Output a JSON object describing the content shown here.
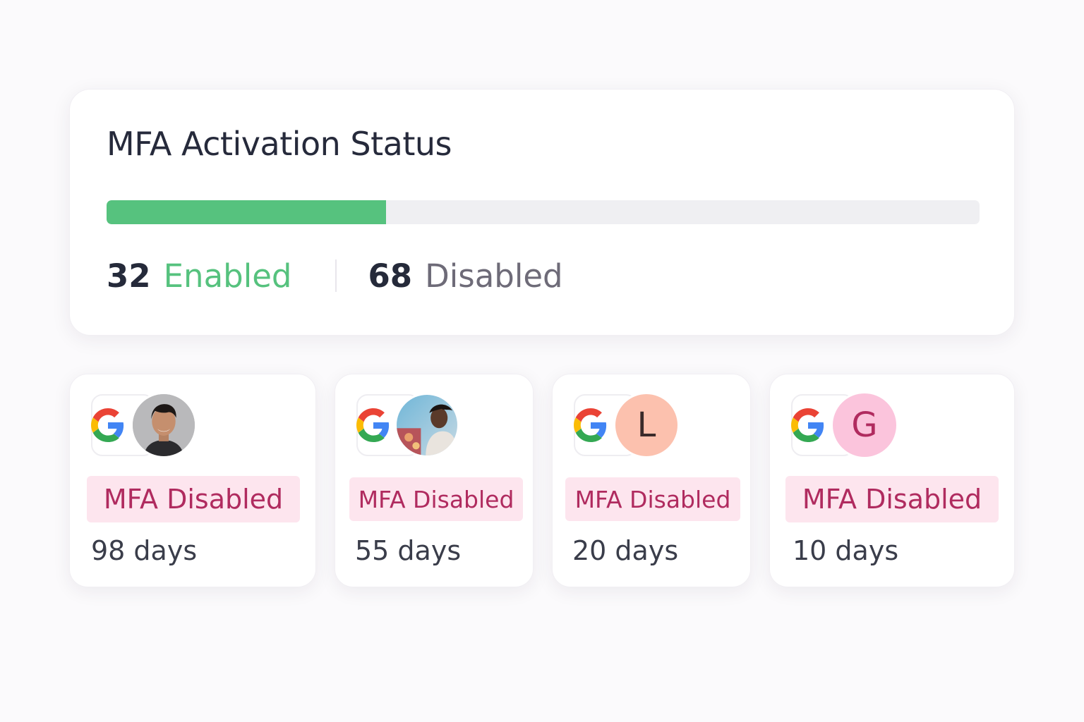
{
  "status": {
    "title": "MFA Activation Status",
    "enabled_count": "32",
    "enabled_label": "Enabled",
    "disabled_count": "68",
    "disabled_label": "Disabled",
    "enabled_fraction": 0.32,
    "colors": {
      "enabled": "#56c27e",
      "track": "#efeff2",
      "disabled_text": "#6e6b78"
    }
  },
  "users": [
    {
      "provider_icon": "google-icon",
      "avatar_type": "photo",
      "avatar_icon": "person-photo",
      "badge": "MFA Disabled",
      "days": "98 days"
    },
    {
      "provider_icon": "google-icon",
      "avatar_type": "photo",
      "avatar_icon": "person-photo",
      "badge": "MFA Disabled",
      "days": "55 days"
    },
    {
      "provider_icon": "google-icon",
      "avatar_type": "letter",
      "avatar_letter": "L",
      "avatar_color": "#fcc1ae",
      "avatar_text_color": "#3a2a2a",
      "badge": "MFA Disabled",
      "days": "20 days"
    },
    {
      "provider_icon": "google-icon",
      "avatar_type": "letter",
      "avatar_letter": "G",
      "avatar_color": "#fbc4dc",
      "avatar_text_color": "#b02b5f",
      "badge": "MFA Disabled",
      "days": "10 days"
    }
  ],
  "colors": {
    "badge_bg": "#fde5ee",
    "badge_text": "#b02b5f"
  }
}
